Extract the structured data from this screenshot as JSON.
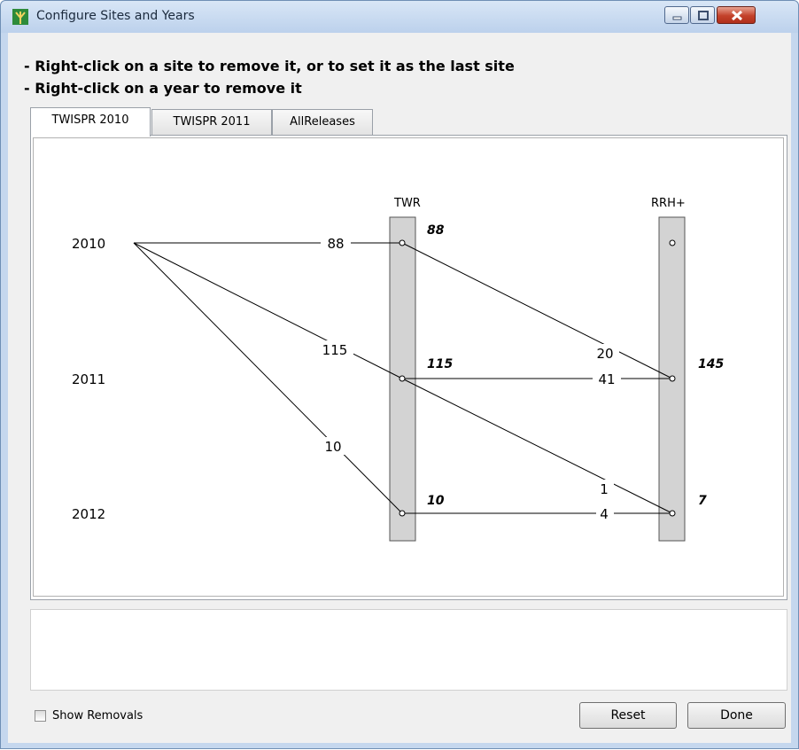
{
  "window": {
    "title": "Configure Sites and Years",
    "icon": "tree-icon"
  },
  "instructions": {
    "line1": "- Right-click on a site to remove it, or to set it as the last site",
    "line2": "- Right-click on a year to remove it"
  },
  "tabs": [
    {
      "label": "TWISPR 2010",
      "active": true
    },
    {
      "label": "TWISPR 2011",
      "active": false
    },
    {
      "label": "AllReleases",
      "active": false
    }
  ],
  "graph": {
    "years": [
      "2010",
      "2011",
      "2012"
    ],
    "sites": [
      {
        "name": "TWR",
        "totals": [
          "88",
          "115",
          "10"
        ]
      },
      {
        "name": "RRH+",
        "totals": [
          "",
          "145",
          "7"
        ]
      }
    ],
    "year_to_site_edges": [
      {
        "from_year": "2010",
        "to_year": "2010",
        "site": "TWR",
        "count": "88"
      },
      {
        "from_year": "2010",
        "to_year": "2011",
        "site": "TWR",
        "count": "115"
      },
      {
        "from_year": "2010",
        "to_year": "2012",
        "site": "TWR",
        "count": "10"
      }
    ],
    "site_to_site_edges": [
      {
        "from_year": "2010",
        "to_year": "2011",
        "count": "20"
      },
      {
        "from_year": "2011",
        "to_year": "2011",
        "count": "41"
      },
      {
        "from_year": "2011",
        "to_year": "2012",
        "count": "1"
      },
      {
        "from_year": "2012",
        "to_year": "2012",
        "count": "4"
      }
    ]
  },
  "footer": {
    "show_removals_label": "Show Removals",
    "show_removals_checked": false,
    "reset_label": "Reset",
    "done_label": "Done"
  },
  "colors": {
    "site_bar_fill": "#d3d3d3",
    "edge": "#000000"
  }
}
